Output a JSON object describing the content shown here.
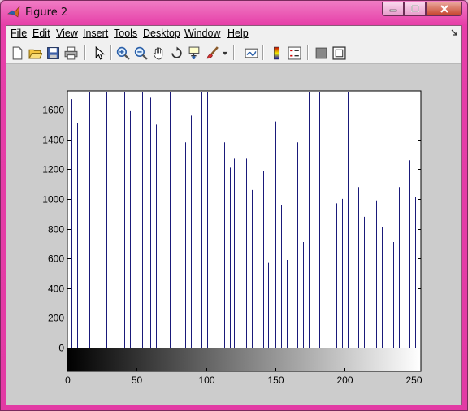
{
  "window": {
    "title": "Figure 2",
    "controls": [
      "minimize",
      "maximize",
      "close"
    ]
  },
  "menubar": {
    "items": [
      {
        "label": "File"
      },
      {
        "label": "Edit"
      },
      {
        "label": "View"
      },
      {
        "label": "Insert"
      },
      {
        "label": "Tools"
      },
      {
        "label": "Desktop"
      },
      {
        "label": "Window"
      },
      {
        "label": "Help"
      }
    ]
  },
  "toolbar": {
    "buttons": [
      "new-figure-icon",
      "open-file-icon",
      "save-icon",
      "print-icon",
      "edit-plot-arrow-icon",
      "zoom-in-icon",
      "zoom-out-icon",
      "pan-hand-icon",
      "rotate-3d-icon",
      "data-cursor-icon",
      "brush-icon",
      "brush-dropdown-icon",
      "link-plot-icon",
      "insert-colorbar-icon",
      "insert-legend-icon",
      "hide-plot-tools-icon",
      "show-plot-tools-icon"
    ]
  },
  "colors": {
    "stem": "#1a1a7a",
    "axes_bg": "#ffffff",
    "figure_bg": "#cccccc",
    "titlebar": "#e23aa4"
  },
  "chart_data": {
    "type": "bar",
    "title": "",
    "xlabel": "",
    "ylabel": "",
    "xlim": [
      0,
      255
    ],
    "ylim": [
      -150,
      1720
    ],
    "xticks": [
      0,
      50,
      100,
      150,
      200,
      250
    ],
    "yticks": [
      0,
      200,
      400,
      600,
      800,
      1000,
      1200,
      1400,
      1600
    ],
    "colorbar": "grayscale gradient 0 to 255 below the axis",
    "series": [
      {
        "x": [
          3,
          7,
          16,
          28,
          41,
          45,
          54,
          60,
          64,
          74,
          81,
          85,
          89,
          97,
          101,
          113,
          117,
          120,
          124,
          129,
          133,
          137,
          141,
          145,
          150,
          154,
          158,
          162,
          166,
          170,
          174,
          182,
          190,
          194,
          198,
          202,
          210,
          214,
          218,
          223,
          227,
          231,
          235,
          239,
          243,
          247,
          251
        ],
        "values": [
          1670,
          1510,
          1720,
          1720,
          1720,
          1590,
          1720,
          1680,
          1500,
          1720,
          1650,
          1380,
          1560,
          1720,
          1720,
          1380,
          1210,
          1270,
          1300,
          1270,
          1060,
          720,
          1190,
          570,
          1520,
          960,
          590,
          1250,
          1380,
          710,
          1720,
          1720,
          1190,
          970,
          1000,
          1720,
          1080,
          880,
          1720,
          990,
          810,
          1450,
          710,
          1080,
          870,
          1260,
          1010
        ]
      }
    ]
  }
}
